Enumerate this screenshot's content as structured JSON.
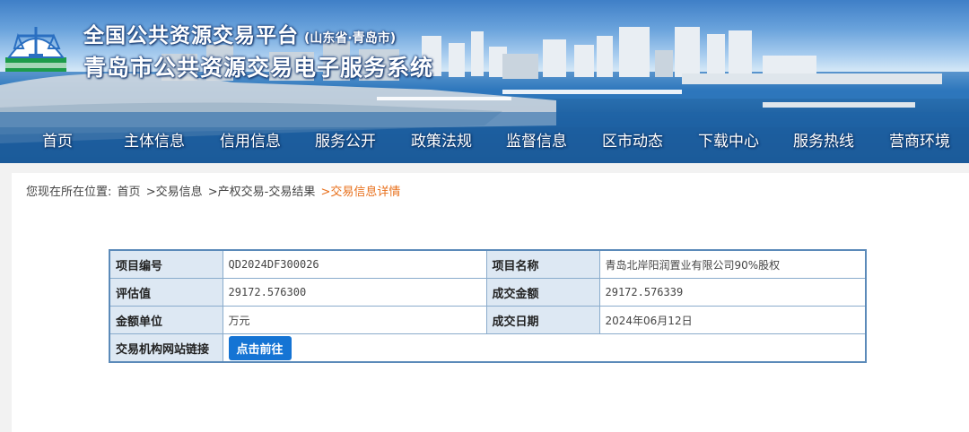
{
  "header": {
    "title_line1": "全国公共资源交易平台",
    "title_line1_sub": "(山东省·青岛市)",
    "title_line2": "青岛市公共资源交易电子服务系统"
  },
  "nav": {
    "items": [
      "首页",
      "主体信息",
      "信用信息",
      "服务公开",
      "政策法规",
      "监督信息",
      "区市动态",
      "下载中心",
      "服务热线",
      "营商环境"
    ]
  },
  "breadcrumb": {
    "prefix": "您现在所在位置:",
    "items": [
      "首页",
      ">交易信息",
      ">产权交易-交易结果",
      ">交易信息详情"
    ]
  },
  "detail": {
    "project_no_label": "项目编号",
    "project_no": "QD2024DF300026",
    "project_name_label": "项目名称",
    "project_name": "青岛北岸阳润置业有限公司90%股权",
    "appraisal_label": "评估值",
    "appraisal": "29172.576300",
    "deal_amount_label": "成交金额",
    "deal_amount": "29172.576339",
    "unit_label": "金额单位",
    "unit": "万元",
    "deal_date_label": "成交日期",
    "deal_date": "2024年06月12日",
    "link_label": "交易机构网站链接",
    "link_button": "点击前往"
  },
  "colors": {
    "accent": "#1574d4",
    "breadcrumb_current": "#e8701c",
    "label_bg": "#dde8f3",
    "table_border": "#5b8ab9"
  }
}
